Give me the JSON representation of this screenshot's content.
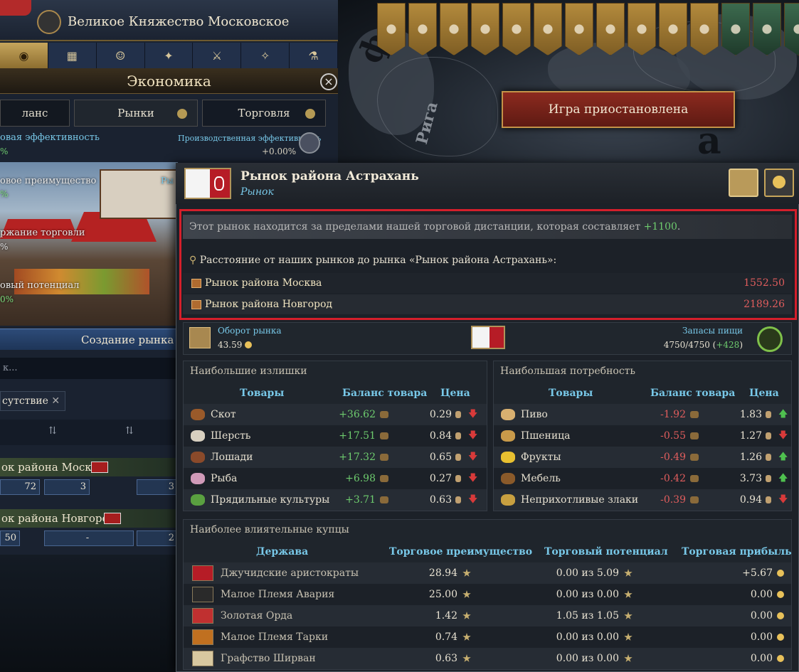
{
  "colors": {
    "accent": "#78c8e8",
    "positive": "#6ecc6e",
    "negative": "#e05d5d",
    "highlight": "#d41f2b"
  },
  "left_panel": {
    "country": "Великое Княжество Московское",
    "tabs": [
      "coins-icon",
      "buildings-icon",
      "people-icon",
      "dove-icon",
      "swords-icon",
      "compass-icon",
      "flask-icon"
    ],
    "section_title": "Экономика",
    "subtabs": [
      "ланс",
      "Рынки",
      "Торговля"
    ],
    "eff_left_label": "овая эффективность",
    "eff_left_value": "%",
    "eff_right_label": "Производственная эффективность",
    "eff_right_value": "+0.00%",
    "scene_labels": [
      {
        "text": "овое преимущество",
        "value": "%"
      },
      {
        "text": "ржание торговли",
        "value": "%"
      },
      {
        "text": "овый потенциал",
        "value": "0%"
      }
    ],
    "scene_cut": "Ры",
    "create_button": "Создание рынка",
    "search_placeholder": "к...",
    "filter_chip": "сутствие",
    "markets": [
      {
        "name": "ок района Москва",
        "cells": [
          "72",
          "3",
          "3"
        ]
      },
      {
        "name": "ок района Новгород",
        "cells": [
          "50",
          "-",
          "2"
        ]
      }
    ]
  },
  "top": {
    "paused": "Игра приостановлена",
    "map_letters": [
      "ф",
      "Рига",
      "а"
    ]
  },
  "popup": {
    "title": "Рынок района Астрахань",
    "subtitle": "Рынок",
    "warning_pre": "Этот рынок находится за пределами нашей  торговой дистанции, которая составляет ",
    "warning_val": "+1100",
    "warning_post": ".",
    "distance_header": "Расстояние от наших рынков до рынка «Рынок района Астрахань»:",
    "distances": [
      {
        "market": "Рынок района Москва",
        "value": "1552.50"
      },
      {
        "market": "Рынок района Новгород",
        "value": "2189.26"
      }
    ],
    "turnover_label": "Оборот рынка",
    "turnover_value": "43.59",
    "food_label": "Запасы пищи",
    "food_value": "4750/4750 (",
    "food_delta": "+428",
    "food_close": ")",
    "surplus": {
      "title": "Наибольшие излишки",
      "headers": [
        "Товары",
        "Баланс товара",
        "Цена"
      ],
      "rows": [
        {
          "good": "Скот",
          "balance": "+36.62",
          "price": "0.29",
          "trend": "down",
          "icon_color": "#9a5a2a"
        },
        {
          "good": "Шерсть",
          "balance": "+17.51",
          "price": "0.84",
          "trend": "down",
          "icon_color": "#d8d0c0"
        },
        {
          "good": "Лошади",
          "balance": "+17.32",
          "price": "0.65",
          "trend": "down",
          "icon_color": "#8a4a2a"
        },
        {
          "good": "Рыба",
          "balance": "+6.98",
          "price": "0.27",
          "trend": "down",
          "icon_color": "#d09ab8"
        },
        {
          "good": "Прядильные культуры",
          "balance": "+3.71",
          "price": "0.63",
          "trend": "down",
          "icon_color": "#5aa040"
        }
      ]
    },
    "demand": {
      "title": "Наибольшая потребность",
      "headers": [
        "Товары",
        "Баланс товара",
        "Цена"
      ],
      "rows": [
        {
          "good": "Пиво",
          "balance": "-1.92",
          "price": "1.83",
          "trend": "up",
          "icon_color": "#d8b070"
        },
        {
          "good": "Пшеница",
          "balance": "-0.55",
          "price": "1.27",
          "trend": "down",
          "icon_color": "#c89a4a"
        },
        {
          "good": "Фрукты",
          "balance": "-0.49",
          "price": "1.26",
          "trend": "up",
          "icon_color": "#e8c030"
        },
        {
          "good": "Мебель",
          "balance": "-0.42",
          "price": "3.73",
          "trend": "up",
          "icon_color": "#8a5a2a"
        },
        {
          "good": "Неприхотливые злаки",
          "balance": "-0.39",
          "price": "0.94",
          "trend": "down",
          "icon_color": "#c8a040"
        }
      ]
    },
    "merchants": {
      "title": "Наиболее влиятельные купцы",
      "headers": [
        "Держава",
        "Торговое преимущество",
        "Торговый потенциал",
        "Торговая прибыль"
      ],
      "rows": [
        {
          "name": "Джучидские аристократы",
          "adv": "28.94",
          "pot": "0.00 из 5.09",
          "profit": "+5.67",
          "flag": "#b61c26"
        },
        {
          "name": "Малое Племя Авария",
          "adv": "25.00",
          "pot": "0.00 из 0.00",
          "profit": "0.00",
          "flag": "#2a2a2a"
        },
        {
          "name": "Золотая Орда",
          "adv": "1.42",
          "pot": "1.05 из 1.05",
          "profit": "0.00",
          "flag": "#c03030"
        },
        {
          "name": "Малое Племя Тарки",
          "adv": "0.74",
          "pot": "0.00 из 0.00",
          "profit": "0.00",
          "flag": "#c07020"
        },
        {
          "name": "Графство Ширван",
          "adv": "0.63",
          "pot": "0.00 из 0.00",
          "profit": "0.00",
          "flag": "#d8c8a0"
        }
      ]
    }
  }
}
